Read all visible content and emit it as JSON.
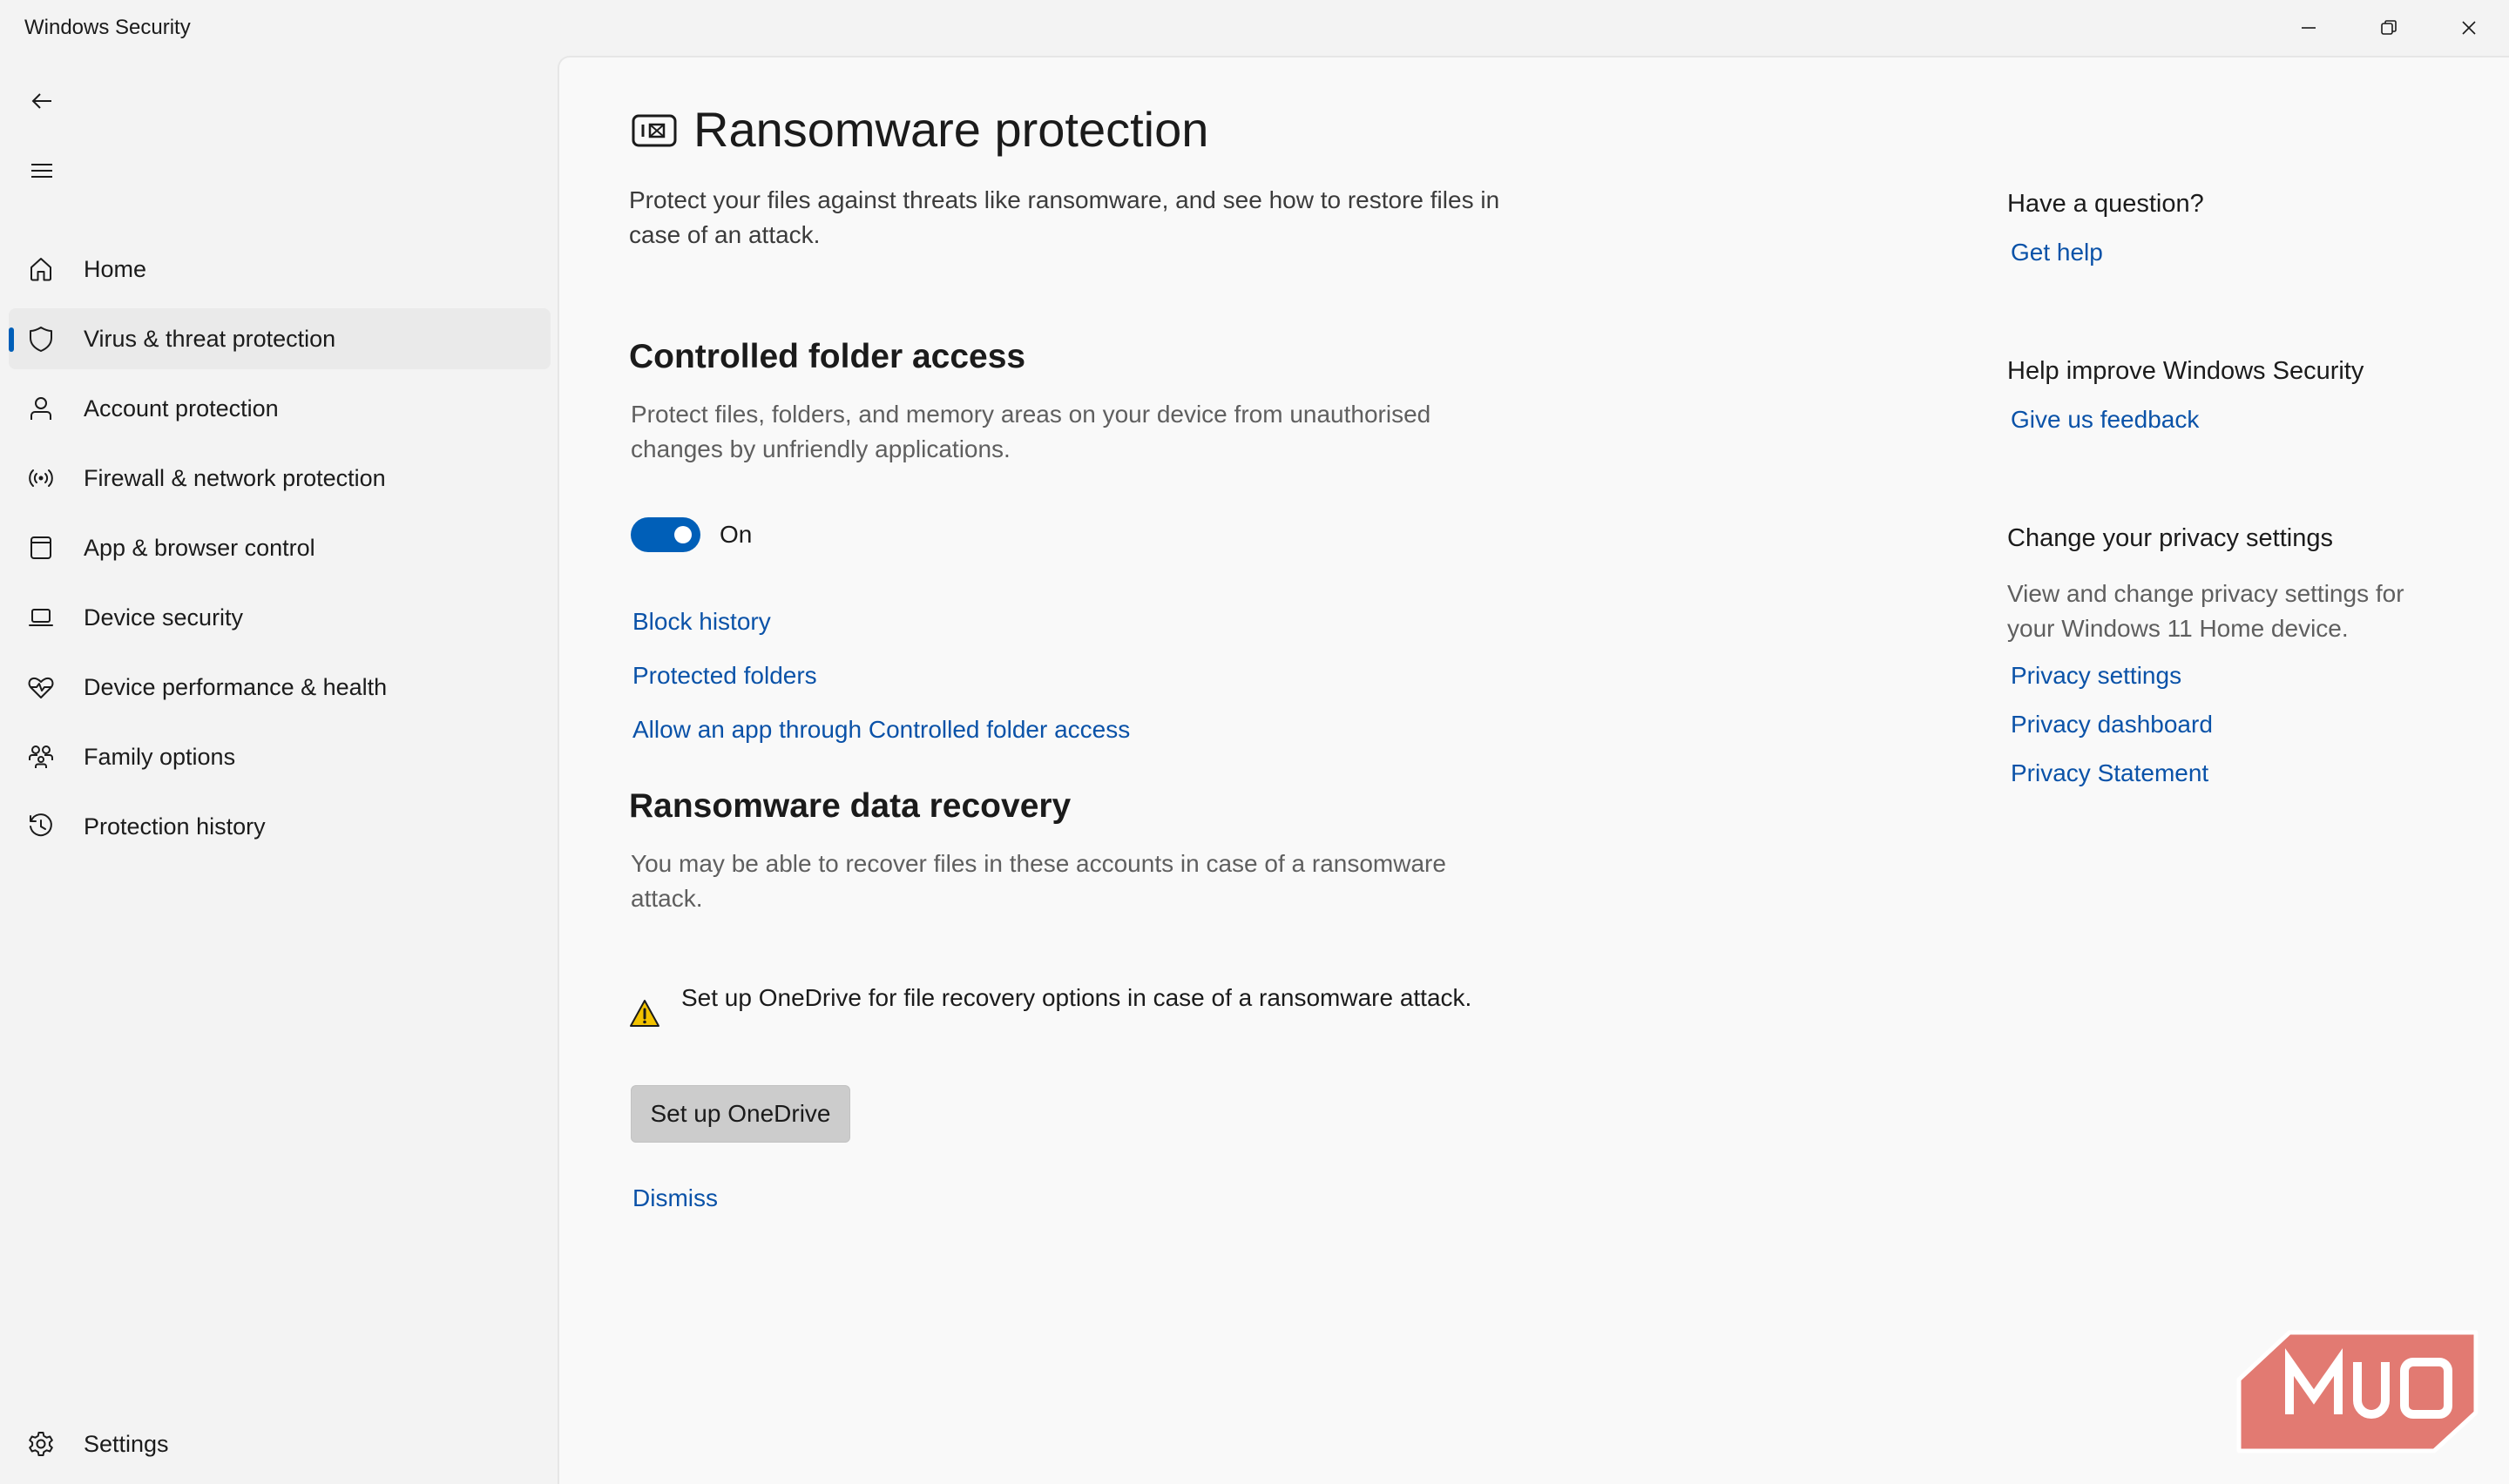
{
  "window": {
    "title": "Windows Security",
    "controls": {
      "minimize": "minimize-icon",
      "maximize": "restore-icon",
      "close": "close-icon"
    }
  },
  "sidebar": {
    "back_icon": "back-arrow-icon",
    "menu_icon": "hamburger-menu-icon",
    "items": [
      {
        "label": "Home",
        "icon": "home-icon",
        "active": false
      },
      {
        "label": "Virus & threat protection",
        "icon": "shield-icon",
        "active": true
      },
      {
        "label": "Account protection",
        "icon": "person-icon",
        "active": false
      },
      {
        "label": "Firewall & network protection",
        "icon": "wireless-signal-icon",
        "active": false
      },
      {
        "label": "App & browser control",
        "icon": "app-window-icon",
        "active": false
      },
      {
        "label": "Device security",
        "icon": "laptop-icon",
        "active": false
      },
      {
        "label": "Device performance & health",
        "icon": "heart-pulse-icon",
        "active": false
      },
      {
        "label": "Family options",
        "icon": "family-icon",
        "active": false
      },
      {
        "label": "Protection history",
        "icon": "history-icon",
        "active": false
      }
    ],
    "settings": {
      "label": "Settings",
      "icon": "gear-icon"
    }
  },
  "main": {
    "title": "Ransomware protection",
    "title_icon": "ransomware-icon",
    "description": "Protect your files against threats like ransomware, and see how to restore files in case of an attack.",
    "controlled_folder": {
      "heading": "Controlled folder access",
      "description": "Protect files, folders, and memory areas on your device from unauthorised changes by unfriendly applications.",
      "toggle_state": "On",
      "toggle_on": true,
      "links": [
        "Block history",
        "Protected folders",
        "Allow an app through Controlled folder access"
      ]
    },
    "recovery": {
      "heading": "Ransomware data recovery",
      "description": "You may be able to recover files in these accounts in case of a ransomware attack.",
      "warning_icon": "warning-icon",
      "warning": "Set up OneDrive for file recovery options in case of a ransomware attack.",
      "button": "Set up OneDrive",
      "dismiss": "Dismiss"
    }
  },
  "right": {
    "question": {
      "heading": "Have a question?",
      "link": "Get help"
    },
    "improve": {
      "heading": "Help improve Windows Security",
      "link": "Give us feedback"
    },
    "privacy": {
      "heading": "Change your privacy settings",
      "description": "View and change privacy settings for your Windows 11 Home device.",
      "links": [
        "Privacy settings",
        "Privacy dashboard",
        "Privacy Statement"
      ]
    }
  },
  "watermark": {
    "text": "MUO",
    "color": "#e27a72"
  },
  "colors": {
    "accent": "#005fb8",
    "link": "#0a52a8",
    "warning": "#f2c200"
  }
}
